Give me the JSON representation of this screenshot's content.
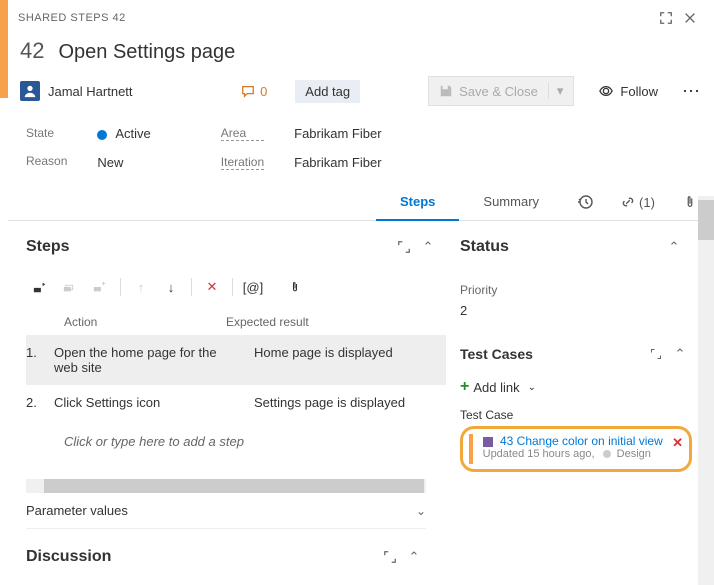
{
  "header": {
    "type_label": "SHARED STEPS 42",
    "id": "42",
    "title": "Open Settings page",
    "assignee": "Jamal Hartnett",
    "discussion_count": "0",
    "add_tag": "Add tag",
    "save_label": "Save & Close",
    "follow_label": "Follow"
  },
  "fields": {
    "state_label": "State",
    "state_value": "Active",
    "reason_label": "Reason",
    "reason_value": "New",
    "area_label": "Area",
    "area_value": "Fabrikam Fiber",
    "iteration_label": "Iteration",
    "iteration_value": "Fabrikam Fiber"
  },
  "tabs": {
    "steps": "Steps",
    "summary": "Summary",
    "links_count": "(1)"
  },
  "steps": {
    "heading": "Steps",
    "action_col": "Action",
    "expected_col": "Expected result",
    "rows": [
      {
        "no": "1.",
        "action": "Open the home page for the web site",
        "expected": "Home page is displayed"
      },
      {
        "no": "2.",
        "action": "Click Settings icon",
        "expected": "Settings page is displayed"
      }
    ],
    "placeholder": "Click or type here to add a step",
    "param_values": "Parameter values",
    "at_char": "[@]"
  },
  "discussion": {
    "heading": "Discussion"
  },
  "rightpane": {
    "status_heading": "Status",
    "priority_label": "Priority",
    "priority_value": "2",
    "testcases_heading": "Test Cases",
    "add_link": "Add link",
    "tc_sub": "Test Case",
    "tc_item": {
      "id": "43",
      "title": "Change color on initial view",
      "updated": "Updated 15 hours ago,",
      "state": "Design"
    }
  }
}
